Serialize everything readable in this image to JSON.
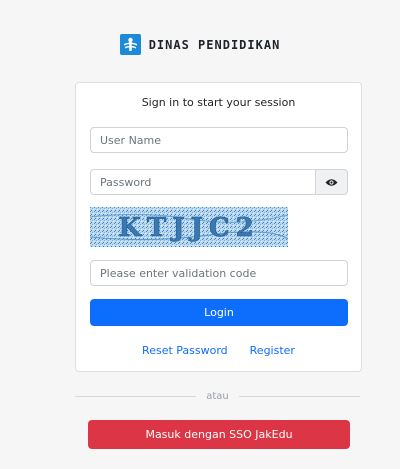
{
  "brand": {
    "logo_icon": "dinas-pendidikan-logo",
    "name": "DINAS PENDIDIKAN"
  },
  "login_card": {
    "title": "Sign in to start your session",
    "username_placeholder": "User Name",
    "username_value": "",
    "password_placeholder": "Password",
    "password_value": "",
    "password_toggle_icon": "eye-icon",
    "captcha_text": "KTJJC2",
    "validation_placeholder": "Please enter validation code",
    "validation_value": "",
    "login_label": "Login",
    "reset_password_label": "Reset Password",
    "register_label": "Register"
  },
  "divider_text": "atau",
  "sso_button_label": "Masuk dengan SSO JakEdu",
  "colors": {
    "primary": "#0d6efd",
    "danger": "#dc3545",
    "brand_blue": "#1c8ad6",
    "background": "#f6f6f7"
  }
}
